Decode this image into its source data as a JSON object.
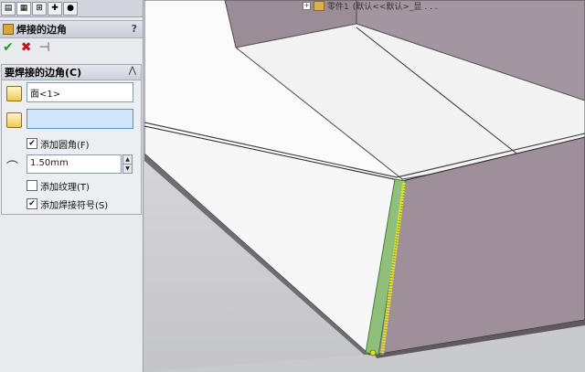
{
  "tabs": [
    {
      "icon": "feature-manager-icon"
    },
    {
      "icon": "property-manager-icon"
    },
    {
      "icon": "configuration-manager-icon"
    },
    {
      "icon": "dimxpert-icon"
    },
    {
      "icon": "display-manager-icon"
    }
  ],
  "property_manager": {
    "title": "焊接的边角",
    "help": "?",
    "ok_icon": "check-icon",
    "cancel_icon": "x-icon",
    "pin_icon": "pushpin-icon"
  },
  "group": {
    "title": "要焊接的边角(C)",
    "collapse": "⋀",
    "corner_field": "面<1>",
    "second_field": "",
    "add_fillet": {
      "label": "添加圆角(F)",
      "checked": true
    },
    "radius": "1.50mm",
    "add_texture": {
      "label": "添加纹理(T)",
      "checked": false
    },
    "add_weld_symbol": {
      "label": "添加焊接符号(S)",
      "checked": true
    }
  },
  "tree": {
    "expander": "+",
    "part_name": "零件1",
    "config": "(默认<<默认>_显 . . ."
  },
  "colors": {
    "panel_bg": "#e9eaee",
    "viewport_bg": "#c9cbcf",
    "sheet_white": "#fafafa",
    "sheet_purple": "#9d8e99",
    "weld_yellow": "#e8e21c"
  }
}
